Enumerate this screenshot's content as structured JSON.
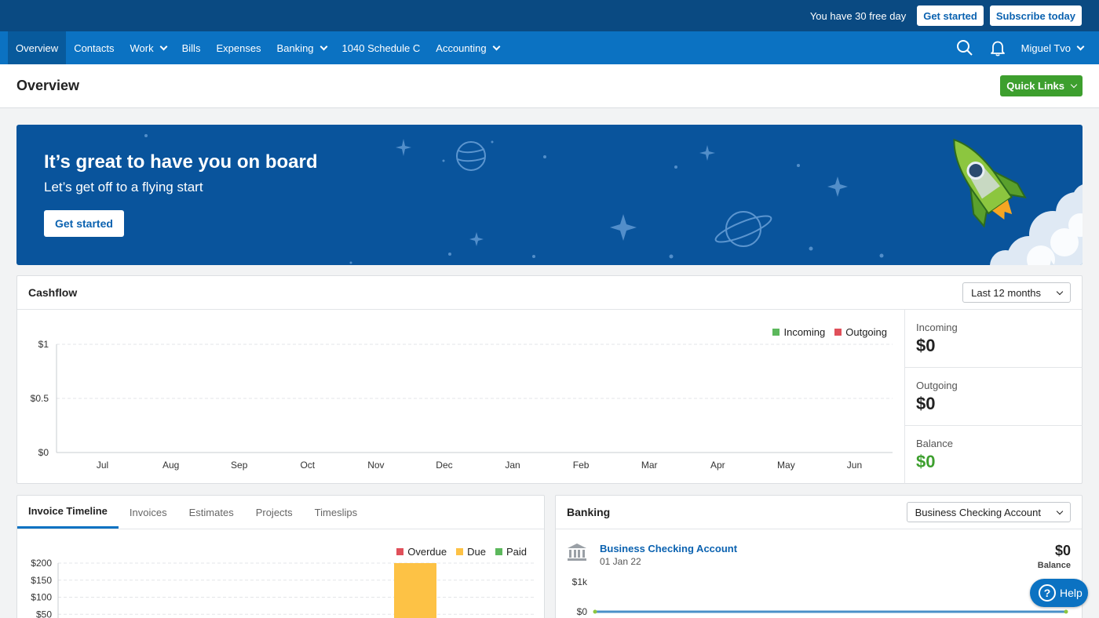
{
  "trial": {
    "message": "You have 30 free day",
    "get_started": "Get started",
    "subscribe": "Subscribe today"
  },
  "nav": {
    "items": [
      {
        "label": "Overview",
        "active": true,
        "dropdown": false
      },
      {
        "label": "Contacts",
        "dropdown": false
      },
      {
        "label": "Work",
        "dropdown": true
      },
      {
        "label": "Bills",
        "dropdown": false
      },
      {
        "label": "Expenses",
        "dropdown": false
      },
      {
        "label": "Banking",
        "dropdown": true
      },
      {
        "label": "1040 Schedule C",
        "dropdown": false
      },
      {
        "label": "Accounting",
        "dropdown": true
      }
    ],
    "user": "Miguel Tvo"
  },
  "page": {
    "title": "Overview",
    "quick_links": "Quick Links"
  },
  "banner": {
    "title": "It’s great to have you on board",
    "subtitle": "Let’s get off to a flying start",
    "button": "Get started"
  },
  "cashflow": {
    "title": "Cashflow",
    "period": "Last 12 months",
    "legend": [
      "Incoming",
      "Outgoing"
    ],
    "stats": [
      {
        "label": "Incoming",
        "value": "$0"
      },
      {
        "label": "Outgoing",
        "value": "$0"
      },
      {
        "label": "Balance",
        "value": "$0"
      }
    ]
  },
  "invoice": {
    "tabs": [
      "Invoice Timeline",
      "Invoices",
      "Estimates",
      "Projects",
      "Timeslips"
    ],
    "legend": [
      "Overdue",
      "Due",
      "Paid"
    ]
  },
  "banking": {
    "title": "Banking",
    "account_select": "Business Checking Account",
    "account_name": "Business Checking Account",
    "account_date": "01 Jan 22",
    "balance": "$0",
    "balance_label": "Balance"
  },
  "help": {
    "label": "Help"
  },
  "colors": {
    "incoming": "#5cb85c",
    "outgoing": "#e0505a",
    "overdue": "#e0505a",
    "due": "#fdc245",
    "paid": "#5cb85c",
    "accent": "#0b72c2",
    "green": "#3d9f2e"
  },
  "chart_data": [
    {
      "type": "bar",
      "title": "Cashflow",
      "categories": [
        "Jul",
        "Aug",
        "Sep",
        "Oct",
        "Nov",
        "Dec",
        "Jan",
        "Feb",
        "Mar",
        "Apr",
        "May",
        "Jun"
      ],
      "series": [
        {
          "name": "Incoming",
          "values": [
            0,
            0,
            0,
            0,
            0,
            0,
            0,
            0,
            0,
            0,
            0,
            0
          ]
        },
        {
          "name": "Outgoing",
          "values": [
            0,
            0,
            0,
            0,
            0,
            0,
            0,
            0,
            0,
            0,
            0,
            0
          ]
        }
      ],
      "yticks": [
        "$0",
        "$0.5",
        "$1"
      ],
      "ylim": [
        0,
        1
      ],
      "grid": true,
      "legend": "top-right"
    },
    {
      "type": "bar",
      "title": "Invoice Timeline",
      "series": [
        {
          "name": "Overdue",
          "values": []
        },
        {
          "name": "Due",
          "values": [
            200
          ]
        },
        {
          "name": "Paid",
          "values": []
        }
      ],
      "yticks": [
        "$50",
        "$100",
        "$150",
        "$200"
      ],
      "ylim": [
        0,
        200
      ],
      "grid": true,
      "legend": "top-right"
    },
    {
      "type": "line",
      "title": "Banking",
      "series": [
        {
          "name": "Business Checking Account",
          "values": [
            0,
            0
          ]
        }
      ],
      "yticks": [
        "$0",
        "$1k"
      ],
      "ylim": [
        0,
        1000
      ]
    }
  ]
}
